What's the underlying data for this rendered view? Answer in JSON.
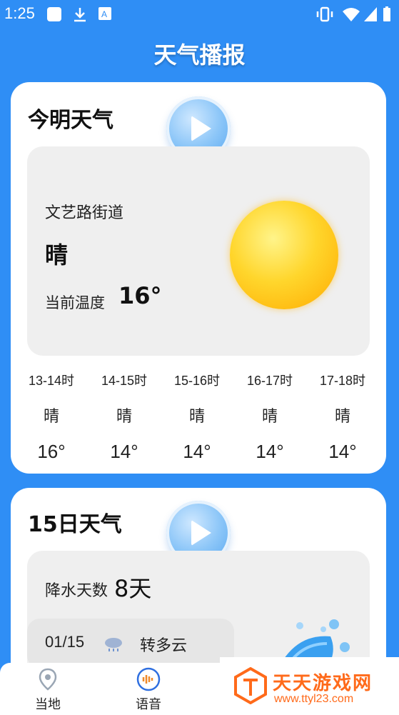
{
  "status_bar": {
    "time": "1:25"
  },
  "app": {
    "title": "天气播报"
  },
  "today_card": {
    "title": "今明天气",
    "location": "文艺路街道",
    "condition": "晴",
    "temp_label": "当前温度",
    "temp_value": "16°",
    "hourly": [
      {
        "time": "13-14时",
        "condition": "晴",
        "temp": "16°"
      },
      {
        "time": "14-15时",
        "condition": "晴",
        "temp": "14°"
      },
      {
        "time": "15-16时",
        "condition": "晴",
        "temp": "14°"
      },
      {
        "time": "16-17时",
        "condition": "晴",
        "temp": "14°"
      },
      {
        "time": "17-18时",
        "condition": "晴",
        "temp": "14°"
      }
    ]
  },
  "fifteen_card": {
    "title": "15日天气",
    "rain_label": "降水天数",
    "rain_value": "8天",
    "first_day": {
      "date": "01/15",
      "condition": "转多云"
    }
  },
  "nav": {
    "items": [
      {
        "label": "当地",
        "icon": "location-pin-icon"
      },
      {
        "label": "语音",
        "icon": "voice-icon"
      }
    ]
  },
  "watermark": {
    "text": "天天游戏网",
    "url": "www.ttyl23.com"
  },
  "colors": {
    "background": "#2f8ef5",
    "card": "#ffffff",
    "panel": "#efefef",
    "accent": "#56a6f0",
    "watermark": "#ff6a1a"
  }
}
